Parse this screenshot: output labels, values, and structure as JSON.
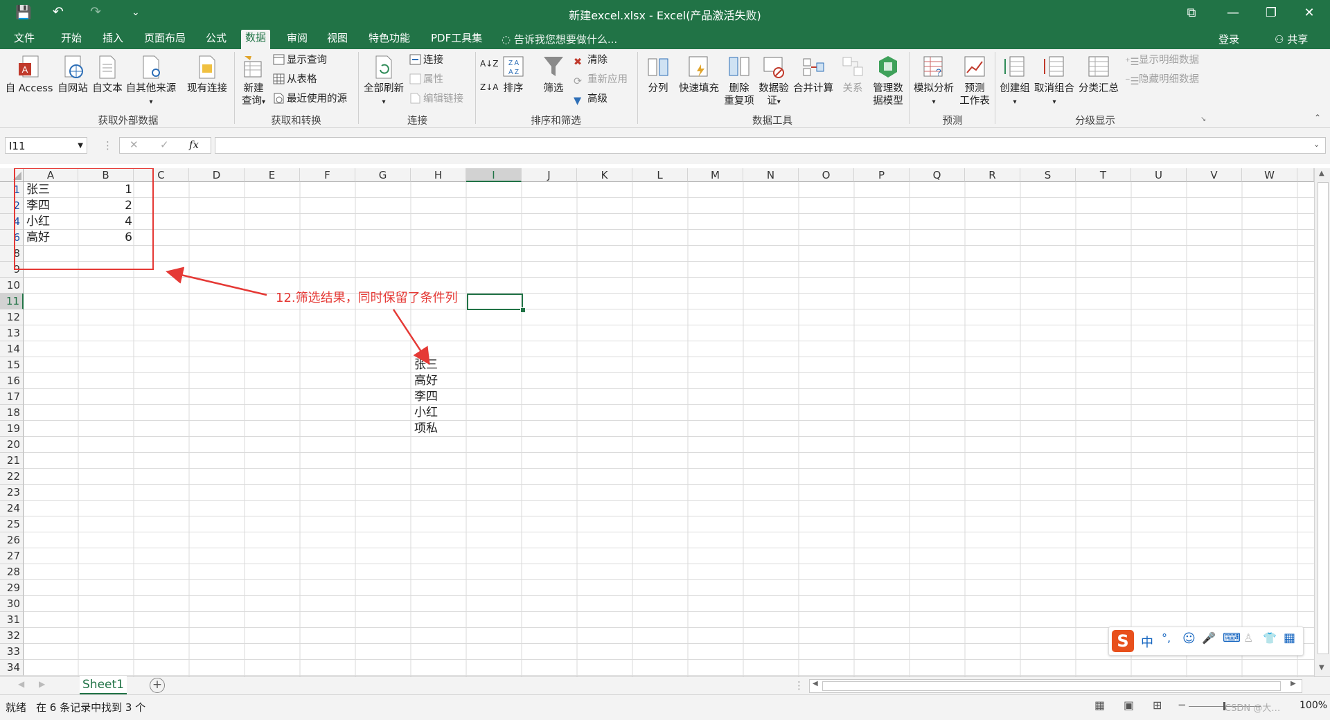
{
  "window": {
    "title": "新建excel.xlsx - Excel(产品激活失败)",
    "controls": {
      "ribbon_display": "⧉",
      "minimize": "—",
      "restore": "❐",
      "close": "✕"
    }
  },
  "qat": {
    "save": "💾",
    "undo": "↶",
    "redo": "↷",
    "customize": "⌄"
  },
  "tabs": {
    "file": "文件",
    "home": "开始",
    "insert": "插入",
    "page_layout": "页面布局",
    "formulas": "公式",
    "data": "数据",
    "review": "审阅",
    "view": "视图",
    "special": "特色功能",
    "pdf": "PDF工具集",
    "tell_me": "告诉我您想要做什么...",
    "login": "登录",
    "share": "共享"
  },
  "ribbon": {
    "ext_data": {
      "access": "自 Access",
      "web": "自网站",
      "text": "自文本",
      "other": "自其他来源",
      "existing": "现有连接",
      "group": "获取外部数据"
    },
    "transform": {
      "new_query_1": "新建",
      "new_query_2": "查询",
      "show_query": "显示查询",
      "from_table": "从表格",
      "recent": "最近使用的源",
      "group": "获取和转换"
    },
    "connections": {
      "refresh_all": "全部刷新",
      "connections": "连接",
      "properties": "属性",
      "edit_links": "编辑链接",
      "group": "连接"
    },
    "sort_filter": {
      "sort": "排序",
      "filter": "筛选",
      "clear": "清除",
      "reapply": "重新应用",
      "advanced": "高级",
      "group": "排序和筛选"
    },
    "data_tools": {
      "text_to_col": "分列",
      "flash_fill": "快速填充",
      "remove_dup_1": "删除",
      "remove_dup_2": "重复项",
      "validation_1": "数据验",
      "validation_2": "证",
      "consolidate": "合并计算",
      "relationships": "关系",
      "model_1": "管理数",
      "model_2": "据模型",
      "group": "数据工具"
    },
    "forecast": {
      "what_if": "模拟分析",
      "sheet_1": "预测",
      "sheet_2": "工作表",
      "group": "预测"
    },
    "outline": {
      "group_btn": "创建组",
      "ungroup": "取消组合",
      "subtotal": "分类汇总",
      "show_detail": "显示明细数据",
      "hide_detail": "隐藏明细数据",
      "group": "分级显示"
    }
  },
  "formula_bar": {
    "name_box": "I11",
    "cancel": "✕",
    "enter": "✓",
    "fx": "fx",
    "value": ""
  },
  "columns": [
    "A",
    "B",
    "C",
    "D",
    "E",
    "F",
    "G",
    "H",
    "I",
    "J",
    "K",
    "L",
    "M",
    "N",
    "O",
    "P",
    "Q",
    "R",
    "S",
    "T",
    "U",
    "V",
    "W"
  ],
  "rows": [
    "1",
    "2",
    "4",
    "6",
    "8",
    "9",
    "10",
    "11",
    "12",
    "13",
    "14",
    "15",
    "16",
    "17",
    "18",
    "19",
    "20",
    "21",
    "22",
    "23",
    "24",
    "25",
    "26",
    "27",
    "28",
    "29",
    "30",
    "31",
    "32",
    "33",
    "34"
  ],
  "cells": {
    "a1": "张三",
    "b1": "1",
    "a2": "李四",
    "b2": "2",
    "a4": "小红",
    "b4": "4",
    "a6": "高好",
    "b6": "6",
    "h15": "张三",
    "h16": "高好",
    "h17": "李四",
    "h18": "小红",
    "h19": "项私"
  },
  "annotation": {
    "text": "12.筛选结果，同时保留了条件列",
    "color": "#e53935"
  },
  "sheet": {
    "tab": "Sheet1",
    "add": "+"
  },
  "status": {
    "ready": "就绪",
    "filter_msg": "在 6 条记录中找到 3 个",
    "watermark": "CSDN @大…",
    "zoom": "100%"
  },
  "ime": {
    "lang": "中",
    "punct": "°,",
    "emoji": "☺",
    "mic": "🎤",
    "keyboard": "⌨"
  },
  "colors": {
    "excel_green": "#217346",
    "selection": "#217346"
  }
}
